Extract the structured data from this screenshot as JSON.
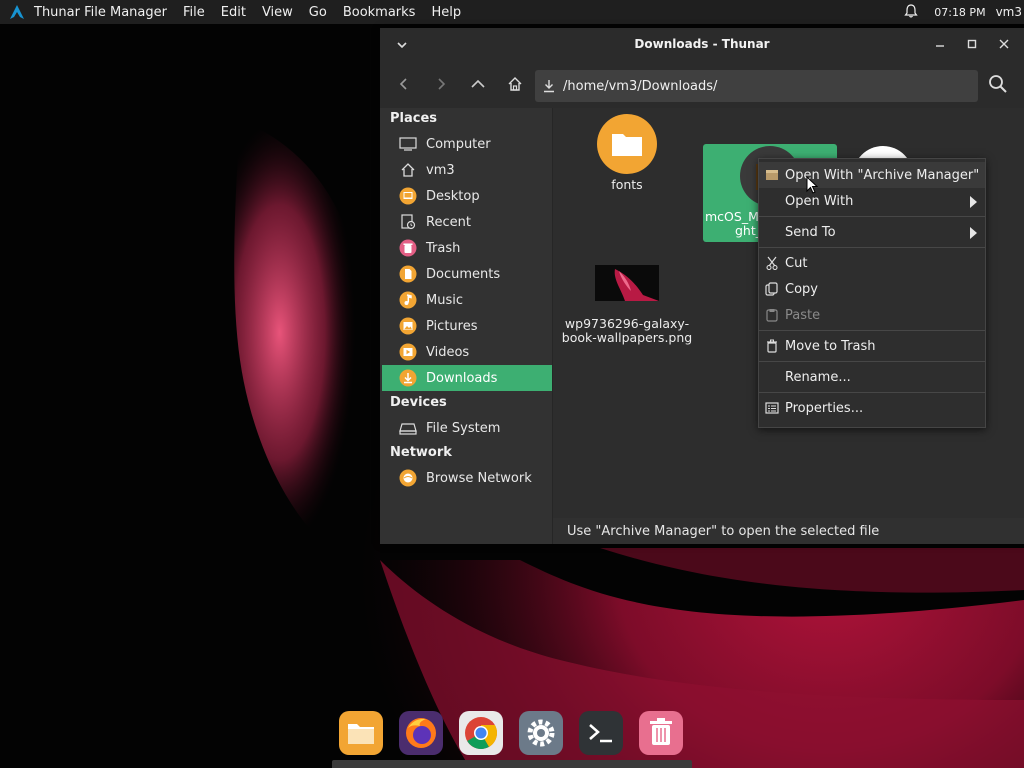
{
  "top_panel": {
    "app_name": "Thunar File Manager",
    "menus": [
      "File",
      "Edit",
      "View",
      "Go",
      "Bookmarks",
      "Help"
    ],
    "clock": "07:18 PM",
    "user": "vm3"
  },
  "window": {
    "title": "Downloads - Thunar",
    "location_path": "/home/vm3/Downloads/"
  },
  "sidebar": {
    "places_heading": "Places",
    "places": [
      {
        "label": "Computer",
        "icon": "computer-icon"
      },
      {
        "label": "vm3",
        "icon": "home-icon"
      },
      {
        "label": "Desktop",
        "icon": "desktop-folder-icon"
      },
      {
        "label": "Recent",
        "icon": "recent-icon"
      },
      {
        "label": "Trash",
        "icon": "trash-icon"
      },
      {
        "label": "Documents",
        "icon": "documents-folder-icon"
      },
      {
        "label": "Music",
        "icon": "music-folder-icon"
      },
      {
        "label": "Pictures",
        "icon": "pictures-folder-icon"
      },
      {
        "label": "Videos",
        "icon": "videos-folder-icon"
      },
      {
        "label": "Downloads",
        "icon": "downloads-folder-icon",
        "active": true
      }
    ],
    "devices_heading": "Devices",
    "devices": [
      {
        "label": "File System",
        "icon": "drive-icon"
      }
    ],
    "network_heading": "Network",
    "network": [
      {
        "label": "Browse Network",
        "icon": "network-icon"
      }
    ]
  },
  "files": [
    {
      "name": "fonts",
      "icon": "folder-icon"
    },
    {
      "name_line1": "mcOS_M",
      "name_line2": "ght_",
      "icon": "archive-icon",
      "selected": true
    },
    {
      "name": "",
      "icon": "archive-file-icon"
    },
    {
      "name_line1": "wp9736296-galaxy-",
      "name_line2": "book-wallpapers.png",
      "icon": "image-thumbnail"
    }
  ],
  "context_menu": {
    "items": [
      {
        "label": "Open With \"Archive Manager\"",
        "icon": "archive-manager-icon"
      },
      {
        "label": "Open With",
        "submenu": true
      },
      {
        "label": "Send To",
        "submenu": true
      },
      {
        "label": "Cut",
        "icon": "cut-icon"
      },
      {
        "label": "Copy",
        "icon": "copy-icon"
      },
      {
        "label": "Paste",
        "icon": "paste-icon",
        "disabled": true
      },
      {
        "label": "Move to Trash",
        "icon": "trash-icon"
      },
      {
        "label": "Rename..."
      },
      {
        "label": "Properties...",
        "icon": "properties-icon"
      }
    ]
  },
  "status_bar": "Use \"Archive Manager\" to open the selected file",
  "dock": [
    "file-manager-icon",
    "firefox-icon",
    "chrome-icon",
    "settings-icon",
    "terminal-icon",
    "trash-icon"
  ],
  "colors": {
    "accent": "#3daf72",
    "folder": "#f2a533",
    "panel": "#1f1f1f",
    "window": "#2d2d2d"
  }
}
